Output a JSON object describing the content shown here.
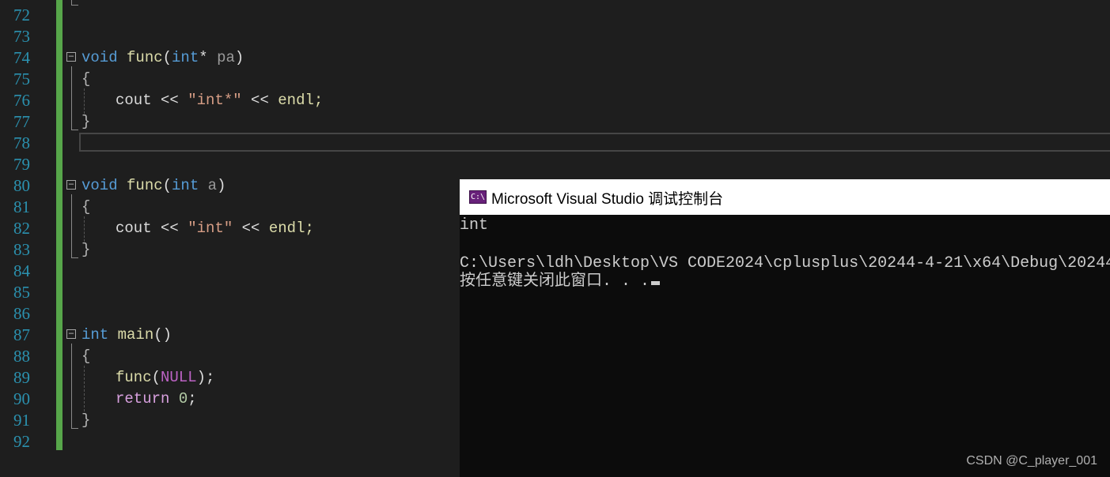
{
  "editor": {
    "line_numbers": [
      "72",
      "73",
      "74",
      "75",
      "76",
      "77",
      "78",
      "79",
      "80",
      "81",
      "82",
      "83",
      "84",
      "85",
      "86",
      "87",
      "88",
      "89",
      "90",
      "91",
      "92"
    ],
    "func1": {
      "sig": {
        "kw_void": "void",
        "name": "func",
        "open": "(",
        "type": "int",
        "ptr": "* ",
        "param": "pa",
        "close": ")"
      },
      "open_brace": "{",
      "body": {
        "cout": "cout ",
        "op1": "<< ",
        "str": "\"int*\"",
        "op2": " << ",
        "endl": "endl;"
      },
      "close_brace": "}"
    },
    "func2": {
      "sig": {
        "kw_void": "void",
        "name": "func",
        "open": "(",
        "type": "int",
        "space": " ",
        "param": "a",
        "close": ")"
      },
      "open_brace": "{",
      "body": {
        "cout": "cout ",
        "op1": "<< ",
        "str": "\"int\"",
        "op2": " << ",
        "endl": "endl;"
      },
      "close_brace": "}"
    },
    "main": {
      "sig": {
        "type": "int",
        "space": " ",
        "name": "main",
        "parens": "()"
      },
      "open_brace": "{",
      "call": {
        "name": "func",
        "open": "(",
        "arg": "NULL",
        "close": ");"
      },
      "ret": {
        "kw": "return",
        "space": " ",
        "val": "0",
        "semi": ";"
      },
      "close_brace": "}"
    }
  },
  "console": {
    "icon_label": "C:\\",
    "title": "Microsoft Visual Studio 调试控制台",
    "lines": {
      "out1": "int",
      "path": "C:\\Users\\ldh\\Desktop\\VS CODE2024\\cplusplus\\20244-4-21\\x64\\Debug\\20244",
      "prompt": "按任意键关闭此窗口. . ."
    }
  },
  "watermark": "CSDN @C_player_001",
  "colors": {
    "keyword": "#569cd6",
    "function": "#dcdcaa",
    "string": "#d69d85",
    "macro": "#bd63c5",
    "change_bar": "#57a64a",
    "line_number": "#2b91af"
  }
}
